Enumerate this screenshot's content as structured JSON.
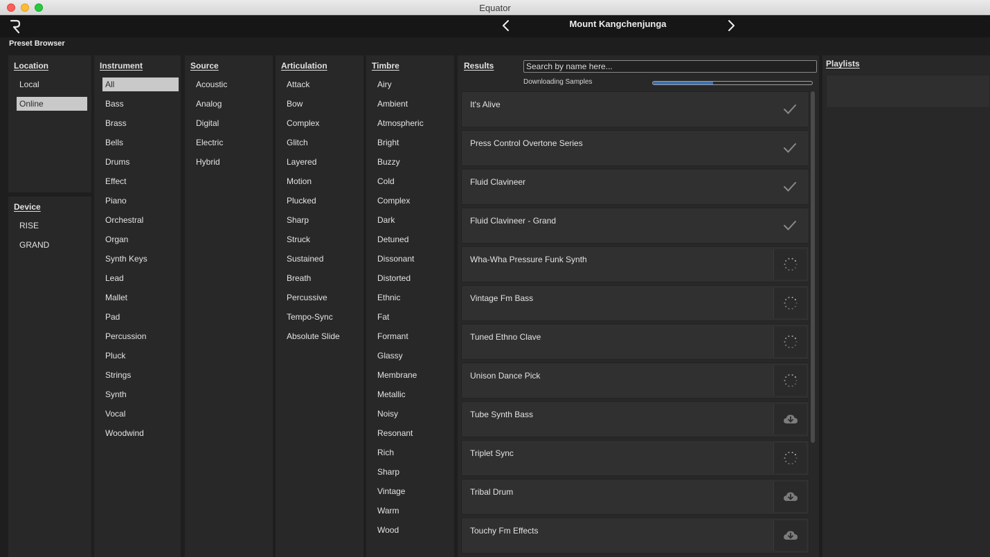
{
  "window": {
    "title": "Equator"
  },
  "header": {
    "preset_name": "Mount Kangchenjunga"
  },
  "browser_label": "Preset Browser",
  "location": {
    "heading": "Location",
    "items": [
      "Local",
      "Online"
    ],
    "selected": "Online"
  },
  "device": {
    "heading": "Device",
    "items": [
      "RISE",
      "GRAND"
    ]
  },
  "instrument": {
    "heading": "Instrument",
    "items": [
      "All",
      "Bass",
      "Brass",
      "Bells",
      "Drums",
      "Effect",
      "Piano",
      "Orchestral",
      "Organ",
      "Synth Keys",
      "Lead",
      "Mallet",
      "Pad",
      "Percussion",
      "Pluck",
      "Strings",
      "Synth",
      "Vocal",
      "Woodwind"
    ],
    "selected": "All"
  },
  "source": {
    "heading": "Source",
    "items": [
      "Acoustic",
      "Analog",
      "Digital",
      "Electric",
      "Hybrid"
    ]
  },
  "articulation": {
    "heading": "Articulation",
    "items": [
      "Attack",
      "Bow",
      "Complex",
      "Glitch",
      "Layered",
      "Motion",
      "Plucked",
      "Sharp",
      "Struck",
      "Sustained",
      "Breath",
      "Percussive",
      "Tempo-Sync",
      "Absolute Slide"
    ]
  },
  "timbre": {
    "heading": "Timbre",
    "items": [
      "Airy",
      "Ambient",
      "Atmospheric",
      "Bright",
      "Buzzy",
      "Cold",
      "Complex",
      "Dark",
      "Detuned",
      "Dissonant",
      "Distorted",
      "Ethnic",
      "Fat",
      "Formant",
      "Glassy",
      "Membrane",
      "Metallic",
      "Noisy",
      "Resonant",
      "Rich",
      "Sharp",
      "Vintage",
      "Warm",
      "Wood"
    ]
  },
  "results": {
    "heading": "Results",
    "search_placeholder": "Search by name here...",
    "download_label": "Downloading Samples",
    "download_progress": 0.38,
    "rows": [
      {
        "name": "It's Alive",
        "status": "downloaded"
      },
      {
        "name": "Press Control Overtone Series",
        "status": "downloaded"
      },
      {
        "name": "Fluid Clavineer",
        "status": "downloaded"
      },
      {
        "name": "Fluid Clavineer - Grand",
        "status": "downloaded"
      },
      {
        "name": "Wha-Wha Pressure Funk Synth",
        "status": "downloading"
      },
      {
        "name": "Vintage Fm Bass",
        "status": "downloading"
      },
      {
        "name": "Tuned Ethno Clave",
        "status": "downloading"
      },
      {
        "name": "Unison Dance Pick",
        "status": "downloading"
      },
      {
        "name": "Tube Synth Bass",
        "status": "download"
      },
      {
        "name": "Triplet Sync",
        "status": "downloading"
      },
      {
        "name": "Tribal Drum",
        "status": "download"
      },
      {
        "name": "Touchy Fm Effects",
        "status": "download"
      }
    ]
  },
  "playlists": {
    "heading": "Playlists"
  },
  "icons": {
    "logo": "roli-logo-icon",
    "prev": "chevron-left-icon",
    "next": "chevron-right-icon",
    "downloaded": "checkmark-icon",
    "downloading": "spinner-icon",
    "download": "cloud-download-icon"
  },
  "colors": {
    "accent_progress": "#3f6fb0",
    "selected_bg": "#c9c9c9",
    "panel_bg": "#282828"
  }
}
